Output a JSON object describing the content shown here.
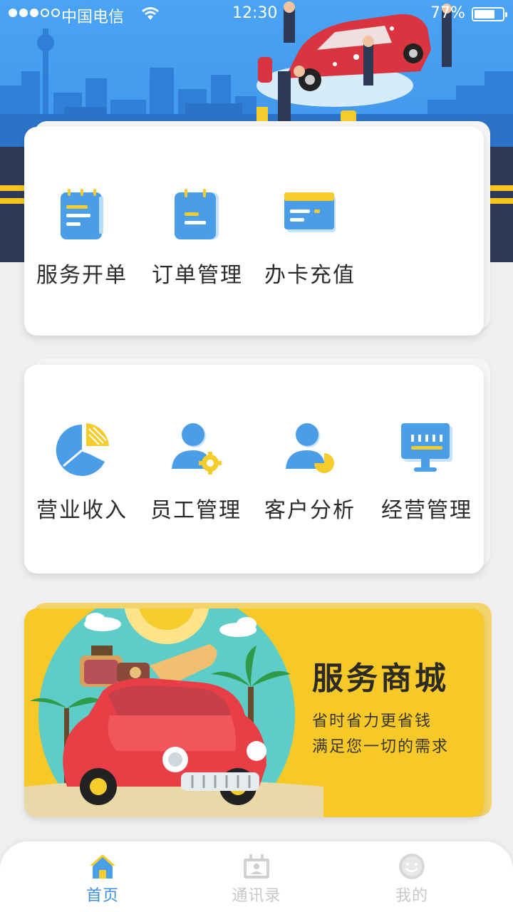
{
  "status_bar": {
    "carrier": "中国电信",
    "time": "12:30",
    "battery": "77%"
  },
  "services": {
    "items": [
      {
        "label": "服务开单",
        "icon": "notepad-icon"
      },
      {
        "label": "订单管理",
        "icon": "order-clipboard-icon"
      },
      {
        "label": "办卡充值",
        "icon": "card-icon"
      }
    ]
  },
  "management": {
    "items": [
      {
        "label": "营业收入",
        "icon": "pie-chart-icon"
      },
      {
        "label": "员工管理",
        "icon": "employee-gear-icon"
      },
      {
        "label": "客户分析",
        "icon": "customer-chart-icon"
      },
      {
        "label": "经营管理",
        "icon": "monitor-icon"
      }
    ]
  },
  "mall": {
    "title": "服务商城",
    "line1": "省时省力更省钱",
    "line2": "满足您一切的需求"
  },
  "tabs": [
    {
      "label": "首页",
      "icon": "home-icon",
      "active": true
    },
    {
      "label": "通讯录",
      "icon": "contacts-icon",
      "active": false
    },
    {
      "label": "我的",
      "icon": "smiley-icon",
      "active": false
    }
  ],
  "colors": {
    "accent": "#3d8fe3",
    "icon_blue": "#4a9ee8",
    "icon_yellow": "#f5cc2c",
    "banner_yellow": "#f7c928",
    "hero_blue": "#4aa3f3",
    "road": "#2e3a55"
  }
}
